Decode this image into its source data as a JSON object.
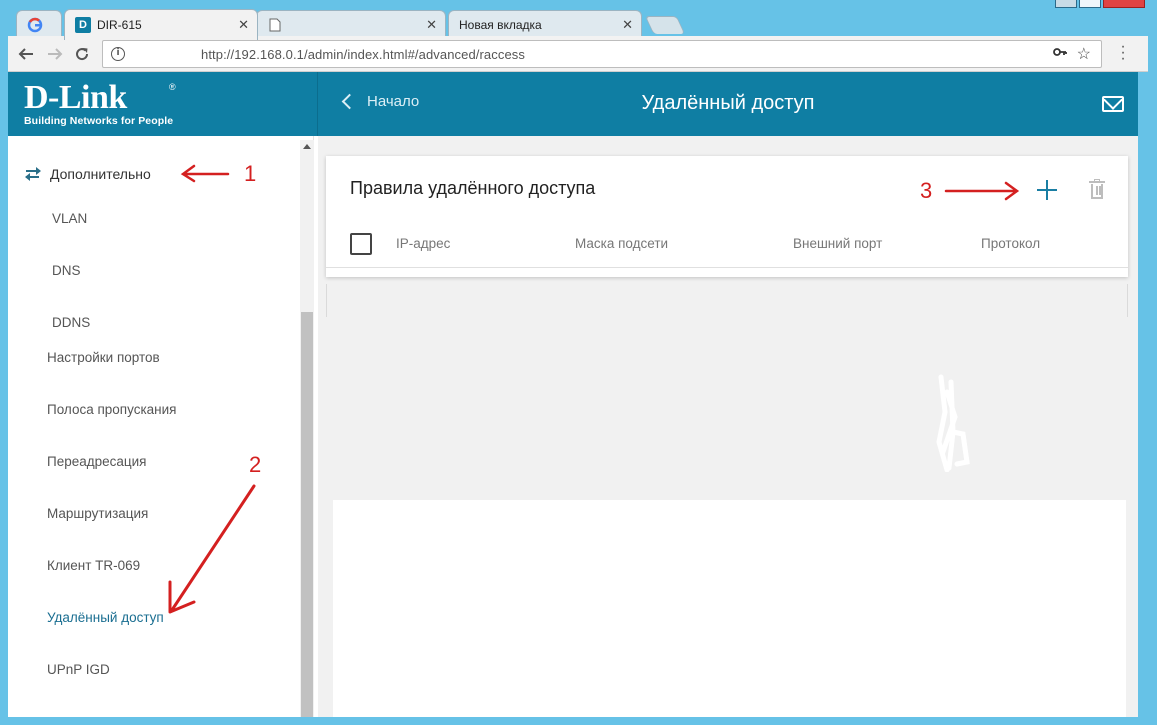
{
  "browser": {
    "tabs": [
      {
        "label": "",
        "favicon": "google-icon"
      },
      {
        "label": "DIR-615",
        "favicon": "dlink-icon",
        "active": true
      },
      {
        "label": "",
        "favicon": "blank-page-icon"
      },
      {
        "label": "Новая вкладка",
        "favicon": "none"
      }
    ],
    "url": "http://192.168.0.1/admin/index.html#/advanced/raccess",
    "info_glyph": "i"
  },
  "header": {
    "logo_brand": "D-Link",
    "logo_tagline": "Building Networks for People",
    "logo_reg": "®",
    "back_label": "Начало",
    "title": "Удалённый доступ"
  },
  "sidebar": {
    "section_label": "Дополнительно",
    "items": [
      {
        "label": "VLAN"
      },
      {
        "label": "DNS"
      },
      {
        "label": "DDNS"
      },
      {
        "label": "Настройки портов"
      },
      {
        "label": "Полоса пропускания"
      },
      {
        "label": "Переадресация"
      },
      {
        "label": "Маршрутизация"
      },
      {
        "label": "Клиент TR-069"
      },
      {
        "label": "Удалённый доступ",
        "active": true
      },
      {
        "label": "UPnP IGD"
      }
    ]
  },
  "card": {
    "title": "Правила удалённого доступа",
    "columns": [
      "IP-адрес",
      "Маска подсети",
      "Внешний порт",
      "Протокол"
    ]
  },
  "annotations": {
    "marker_1": "1",
    "marker_2": "2",
    "marker_3": "3",
    "color": "#d42020"
  },
  "colors": {
    "header_bg": "#0f7ea3",
    "accent": "#1a7ea3",
    "chrome_bg": "#66c2e7"
  }
}
